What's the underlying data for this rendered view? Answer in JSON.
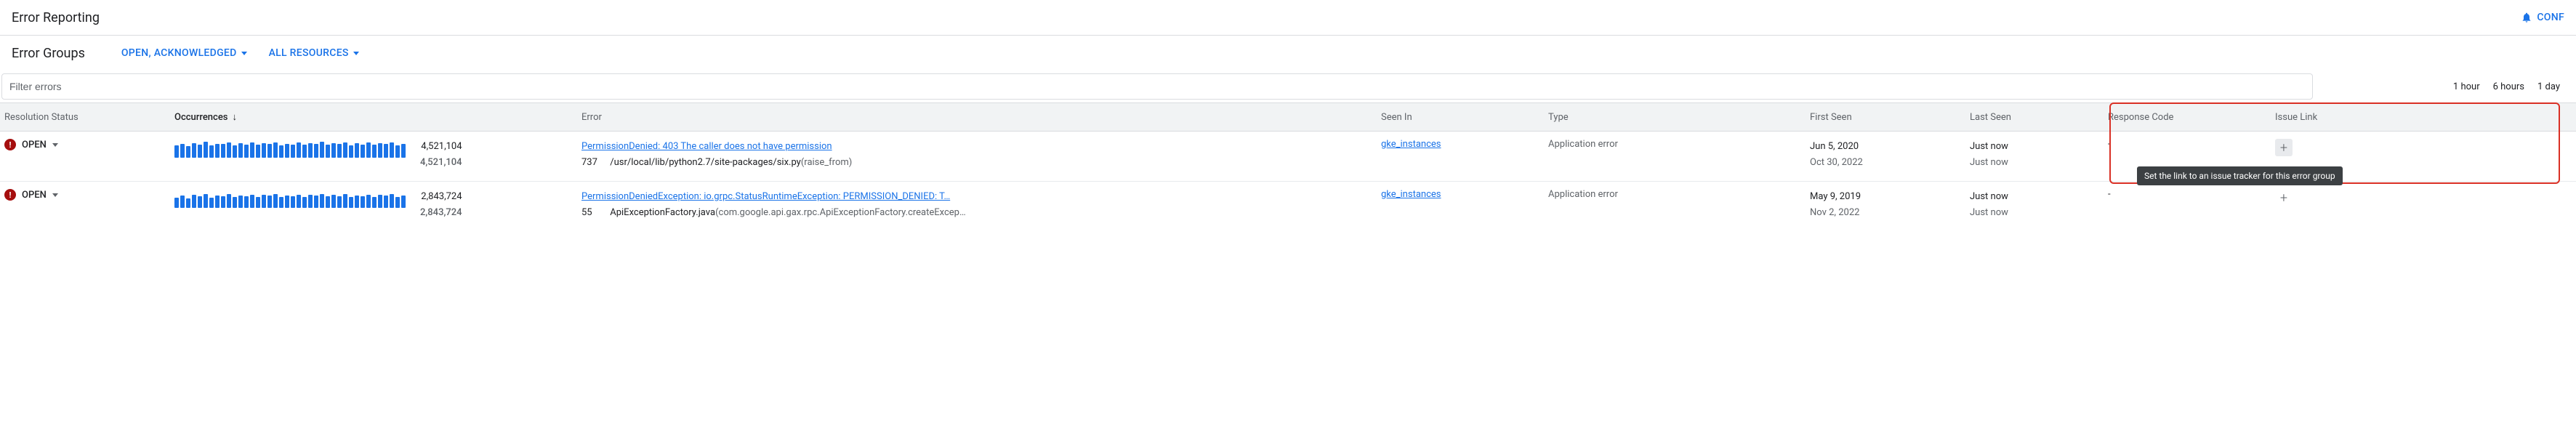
{
  "header": {
    "title": "Error Reporting",
    "config_label": "CONF"
  },
  "filters": {
    "title": "Error Groups",
    "status_filter": "OPEN, ACKNOWLEDGED",
    "resource_filter": "ALL RESOURCES"
  },
  "search": {
    "placeholder": "Filter errors"
  },
  "time_ranges": [
    "1 hour",
    "6 hours",
    "1 day"
  ],
  "columns": {
    "status": "Resolution Status",
    "occurrences": "Occurrences",
    "error": "Error",
    "seen_in": "Seen In",
    "type": "Type",
    "first_seen": "First Seen",
    "last_seen": "Last Seen",
    "response_code": "Response Code",
    "issue_link": "Issue Link"
  },
  "rows": [
    {
      "status": "OPEN",
      "occurrences_primary": "4,521,104",
      "occurrences_secondary": "4,521,104",
      "error_title": "PermissionDenied: 403 The caller does not have permission",
      "error_sub_count": "737",
      "error_sub_path": "/usr/local/lib/python2.7/site-packages/six.py",
      "error_sub_func": "(raise_from)",
      "seen_in": "gke_instances",
      "type": "Application error",
      "first_seen": "Jun 5, 2020",
      "first_seen_sub": "Oct 30, 2022",
      "last_seen": "Just now",
      "last_seen_sub": "Just now",
      "response_code": "-"
    },
    {
      "status": "OPEN",
      "occurrences_primary": "2,843,724",
      "occurrences_secondary": "2,843,724",
      "error_title": "PermissionDeniedException: io.grpc.StatusRuntimeException: PERMISSION_DENIED: T…",
      "error_sub_count": "55",
      "error_sub_path": "ApiExceptionFactory.java",
      "error_sub_func": "(com.google.api.gax.rpc.ApiExceptionFactory.createExcep…",
      "seen_in": "gke_instances",
      "type": "Application error",
      "first_seen": "May 9, 2019",
      "first_seen_sub": "Nov 2, 2022",
      "last_seen": "Just now",
      "last_seen_sub": "Just now",
      "response_code": "-"
    }
  ],
  "tooltip": "Set the link to an issue tracker for this error group",
  "icons": {
    "bell": "bell-icon",
    "sort_down": "↓",
    "plus": "+",
    "error": "!"
  }
}
